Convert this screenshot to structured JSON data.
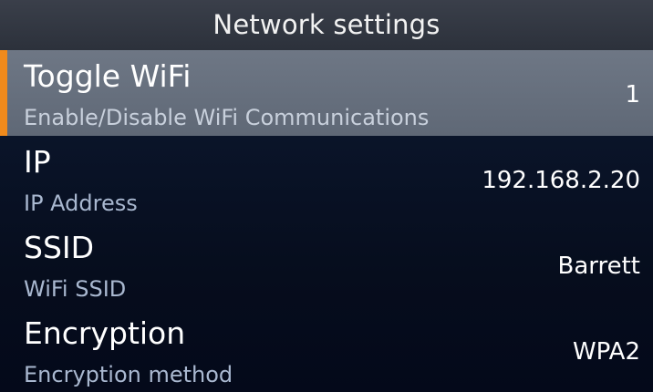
{
  "header": {
    "title": "Network settings"
  },
  "items": [
    {
      "title": "Toggle WiFi",
      "subtitle": "Enable/Disable WiFi Communications",
      "value": "1",
      "selected": true
    },
    {
      "title": "IP",
      "subtitle": "IP Address",
      "value": "192.168.2.20",
      "selected": false
    },
    {
      "title": "SSID",
      "subtitle": "WiFi SSID",
      "value": "Barrett",
      "selected": false
    },
    {
      "title": "Encryption",
      "subtitle": "Encryption method",
      "value": "WPA2",
      "selected": false
    }
  ],
  "colors": {
    "selection_marker": "#f08a1c",
    "selected_row": "#676f7d",
    "background": "#0a1429",
    "subtitle_text": "#a9b8d0"
  }
}
